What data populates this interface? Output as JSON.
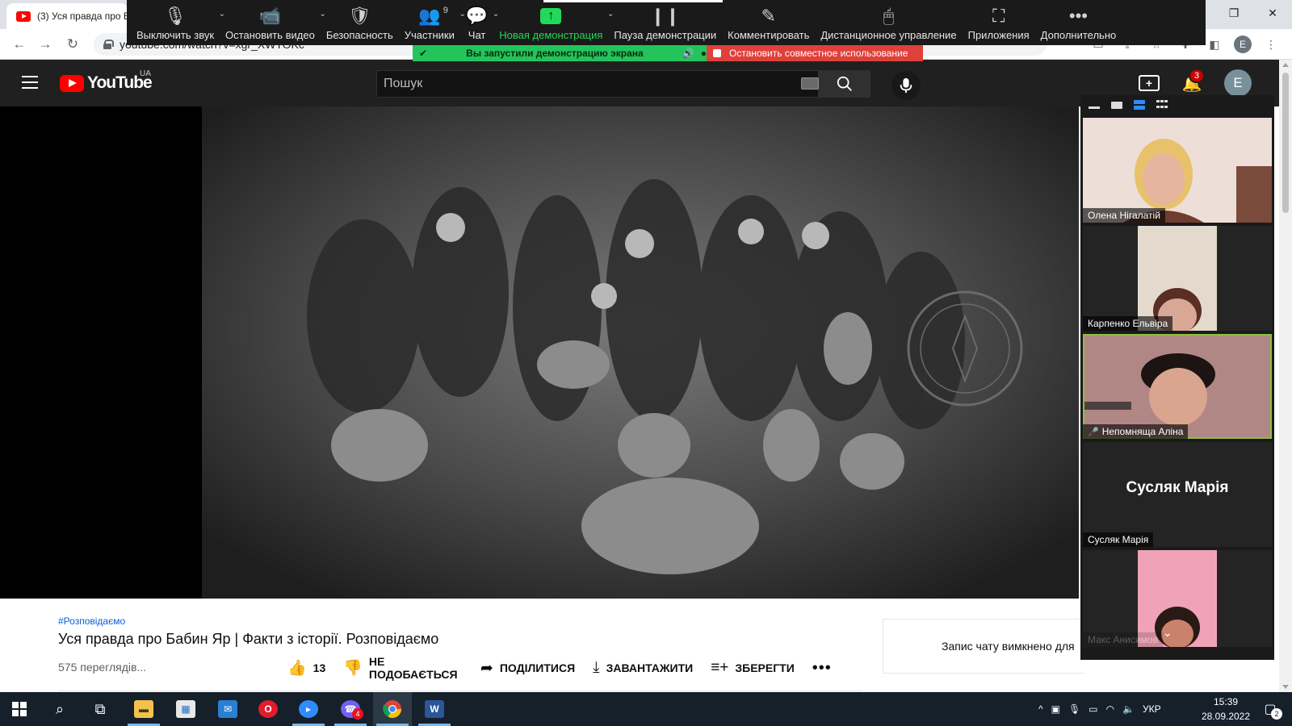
{
  "browser": {
    "tab_title": "(3) Уся правда про Б",
    "url": "youtube.com/watch?v=xgr_XWTOKc"
  },
  "zoom": {
    "toolbar": [
      {
        "label": "Выключить звук",
        "icon": "microphone-icon",
        "glyph": "🎙",
        "caret": true
      },
      {
        "label": "Остановить видео",
        "icon": "video-camera-icon",
        "glyph": "📹",
        "caret": true
      },
      {
        "label": "Безопасность",
        "icon": "shield-icon",
        "glyph": "🛡",
        "caret": false
      },
      {
        "label": "Участники",
        "icon": "participants-icon",
        "glyph": "👥",
        "caret": true,
        "count": "9"
      },
      {
        "label": "Чат",
        "icon": "chat-icon",
        "glyph": "💬",
        "caret": true
      },
      {
        "label": "Новая демонстрация",
        "icon": "new-share-icon",
        "glyph": "↑",
        "caret": true,
        "highlight": true
      },
      {
        "label": "Пауза демонстрации",
        "icon": "pause-icon",
        "glyph": "❙❙",
        "caret": false
      },
      {
        "label": "Комментировать",
        "icon": "pencil-icon",
        "glyph": "✎",
        "caret": false
      },
      {
        "label": "Дистанционное управление",
        "icon": "mouse-icon",
        "glyph": "🖱",
        "caret": false
      },
      {
        "label": "Приложения",
        "icon": "apps-icon",
        "glyph": "⛶",
        "caret": false
      },
      {
        "label": "Дополнительно",
        "icon": "more-icon",
        "glyph": "•••",
        "caret": false
      }
    ],
    "share_banner": "Вы запустили демонстрацию экрана",
    "stop_share": "Остановить совместное использование",
    "accent_green": "#23d959",
    "stop_red": "#e0403a"
  },
  "youtube": {
    "logo_text": "YouTube",
    "country": "UA",
    "search_placeholder": "Пошук",
    "notification_count": "3",
    "avatar_letter": "E",
    "hashtag": "#Розповідаємо",
    "video_title": "Уся правда про Бабин Яр | Факти з історії. Розповідаємо",
    "views": "575 переглядів...",
    "like_count": "13",
    "dislike_label": "НЕ ПОДОБАЄТЬСЯ",
    "share_label": "ПОДІЛИТИСЯ",
    "download_label": "ЗАВАНТАЖИТИ",
    "save_label": "ЗБЕРЕГТИ",
    "chat_notice": "Запис чату вимкнено для"
  },
  "gallery": {
    "participants": [
      {
        "name": "Олена Нігалатій",
        "video": "video"
      },
      {
        "name": "Карпенко Ельвіра",
        "video": "video"
      },
      {
        "name": "Непомняща Аліна",
        "video": "video",
        "muted": true,
        "active": true
      },
      {
        "name": "Сусляк Марія",
        "video": "off"
      },
      {
        "name": "Макс Анисимов",
        "video": "video"
      }
    ]
  },
  "taskbar": {
    "language": "УКР",
    "time": "15:39",
    "date": "28.09.2022",
    "notification_count": "2",
    "viber_badge": "4"
  }
}
